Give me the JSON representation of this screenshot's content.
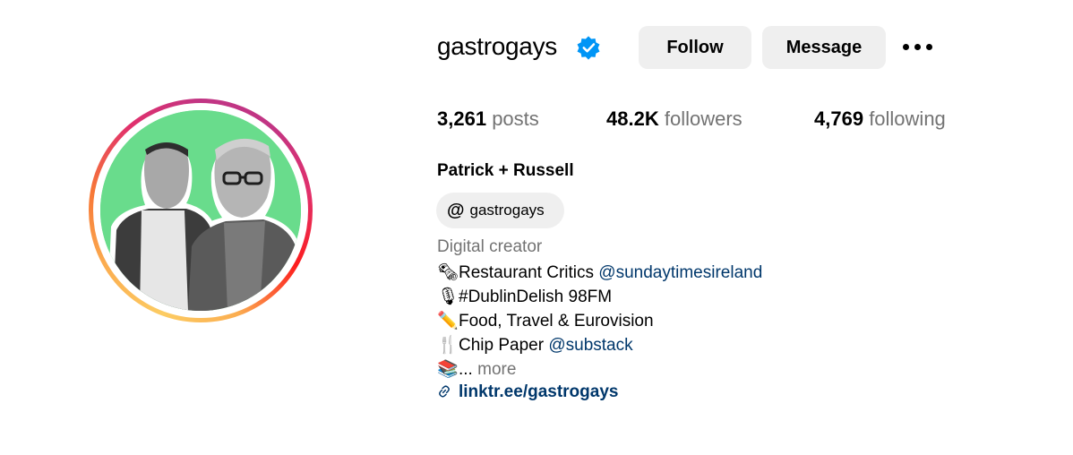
{
  "profile": {
    "username": "gastrogays",
    "verified_icon": "verified-badge-icon",
    "full_name": "Patrick + Russell",
    "avatar_icon": "profile-photo"
  },
  "actions": {
    "follow_label": "Follow",
    "message_label": "Message",
    "more_icon": "more-options-icon"
  },
  "stats": {
    "posts_count": "3,261",
    "posts_label": "posts",
    "followers_count": "48.2K",
    "followers_label": "followers",
    "following_count": "4,769",
    "following_label": "following"
  },
  "threads": {
    "icon": "threads-icon",
    "handle": "gastrogays"
  },
  "bio": {
    "category": "Digital creator",
    "line1": {
      "emoji": "🗞",
      "text": "Restaurant Critics ",
      "mention": "@sundaytimesireland"
    },
    "line2": {
      "emoji": "🎙",
      "text": "#DublinDelish 98FM"
    },
    "line3": {
      "emoji": "✏️",
      "text": "Food, Travel & Eurovision"
    },
    "line4": {
      "emoji": "🍴",
      "text": "Chip Paper ",
      "mention": "@substack"
    },
    "line5": {
      "emoji": "📚",
      "text": "...",
      "more": "more"
    },
    "link": {
      "icon": "link-icon",
      "text": "linktr.ee/gastrogays"
    }
  },
  "colors": {
    "link": "#00376b",
    "secondary_text": "#737373",
    "button_bg": "#efefef",
    "verified": "#0095f6",
    "avatar_bg": "#69dc8c"
  }
}
